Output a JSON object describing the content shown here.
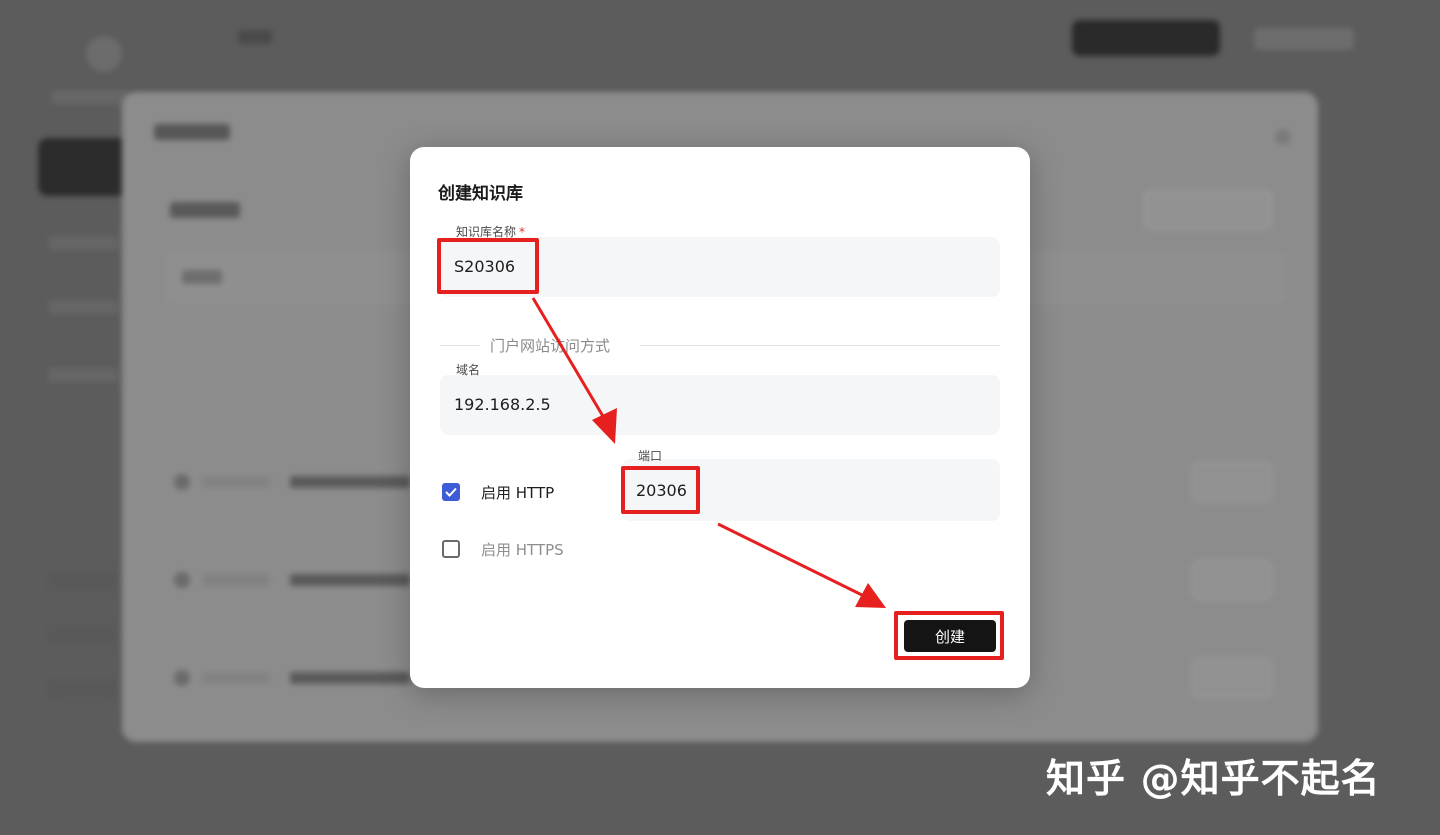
{
  "dialog": {
    "title": "创建知识库",
    "name_field": {
      "label": "知识库名称",
      "required_mark": "*",
      "value": "S20306"
    },
    "access_section": {
      "label": "门户网站访问方式"
    },
    "domain_field": {
      "label": "域名",
      "value": "192.168.2.5"
    },
    "http": {
      "label": "启用 HTTP",
      "checked": true
    },
    "https": {
      "label": "启用 HTTPS",
      "checked": false
    },
    "port_field": {
      "label": "端口",
      "value": "20306"
    },
    "create_button": "创建"
  },
  "annotations": {
    "highlight_color": "#e5201e"
  },
  "watermark": "知乎 @知乎不起名",
  "colors": {
    "checkbox_checked": "#3e5bd8",
    "primary_button": "#141414",
    "required_mark": "#e0322b",
    "overlay_background": "#5c5c5c"
  }
}
